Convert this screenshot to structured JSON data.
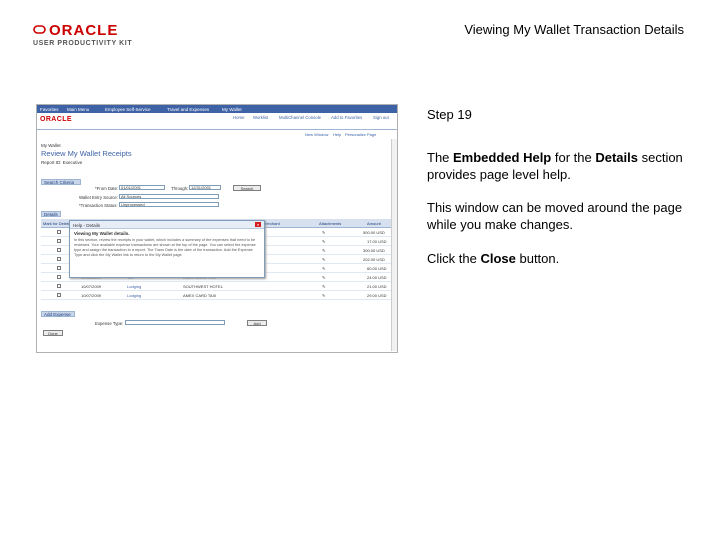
{
  "header": {
    "logo_text": "ORACLE",
    "logo_subtitle": "USER PRODUCTIVITY KIT",
    "title": "Viewing My Wallet Transaction Details"
  },
  "screenshot": {
    "top_nav": [
      "Favorites",
      "Main Menu",
      "Employee Self-Service",
      "Travel and Expenses",
      "My Wallet"
    ],
    "brand": "ORACLE",
    "menu_links": [
      "Home",
      "Worklist",
      "MultiChannel Console",
      "Add to Favorites",
      "Sign out"
    ],
    "tool_links": [
      "New Window",
      "Help",
      "Personalize Page"
    ],
    "breadcrumb": "My Wallet",
    "page_title": "Review My Wallet Receipts",
    "report_id": "Report ID: Executive",
    "search_section": "Search Criteria",
    "from_date_label": "*From Date:",
    "from_date_value": "01/01/2001",
    "through_label": "Through:",
    "through_value": "12/31/2001",
    "search_button": "Search",
    "source_label": "Wallet Entry Source:",
    "source_value": "All Sources",
    "status_label": "*Transaction Status:",
    "status_value": "Unprocessed",
    "details_section": "Details",
    "columns": [
      "Mark for Delete",
      "Trans Date",
      "Expense Type",
      "Merchant",
      "Attachments",
      "Amount"
    ],
    "rows": [
      {
        "date": "",
        "type": "",
        "merchant": "",
        "amount": "500.00 USD"
      },
      {
        "date": "",
        "type": "",
        "merchant": "",
        "amount": "17.00 USD"
      },
      {
        "date": "",
        "type": "",
        "merchant": "",
        "amount": "300.00 USD"
      },
      {
        "date": "",
        "type": "",
        "merchant": "",
        "amount": "202.00 USD"
      },
      {
        "date": "",
        "type": "",
        "merchant": "",
        "amount": "60.00 USD"
      },
      {
        "date": "10/08/2009",
        "type": "Taxi",
        "merchant": "AMEX CARD TAXI",
        "amount": "24.00 USD"
      },
      {
        "date": "10/07/2009",
        "type": "Lodging",
        "merchant": "SOUTHWEST HOTEL",
        "amount": "21.00 USD"
      },
      {
        "date": "10/07/2009",
        "type": "Lodging",
        "merchant": "AMEX CARD TAXI",
        "amount": "29.00 USD"
      }
    ],
    "add_expense_section": "Add Expense",
    "expense_type_label": "Expense Type:",
    "add_button": "Add",
    "done_button": "Done",
    "popup": {
      "title": "Help - Details",
      "heading": "Viewing My Wallet details.",
      "body": "In this section, review the receipts in your wallet, which includes a summary of the expenses that need to be reviewed. Your available expense transactions are shown at the top of the page. You can select the expense type and assign the transaction to a report. The Trans Date is the date of the transaction. Add the Expense Type and click the My Wallet link to return to the My Wallet page."
    }
  },
  "instructions": {
    "step": "Step 19",
    "p1_before": "The ",
    "p1_bold1": "Embedded Help",
    "p1_mid": " for the ",
    "p1_bold2": "Details",
    "p1_after": " section provides page level help.",
    "p2": "This window can be moved around the page while you make changes.",
    "p3_before": "Click the ",
    "p3_bold": "Close",
    "p3_after": " button."
  },
  "colors": {
    "oracle_red": "#c00000",
    "nav_blue": "#3e62a6",
    "close_red": "#d21f1f"
  }
}
